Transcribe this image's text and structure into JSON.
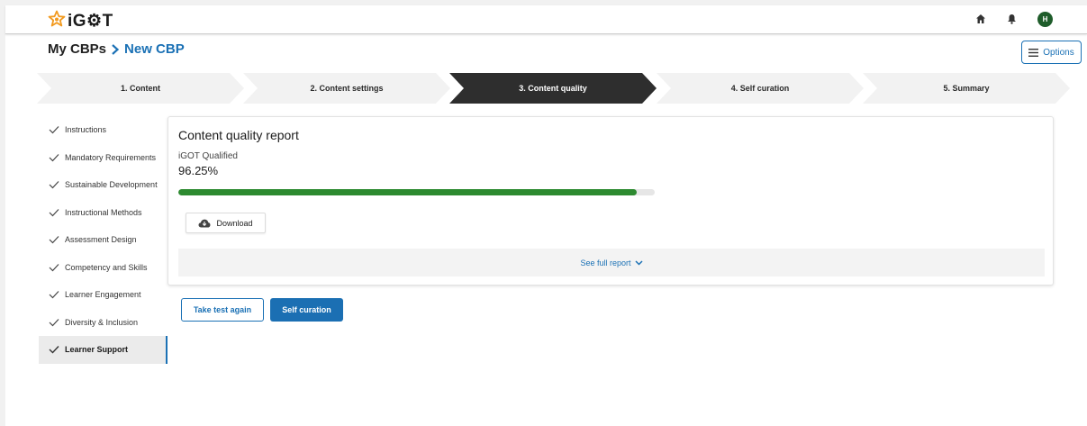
{
  "app": {
    "logo_text": "iG⚙T",
    "brand_color": "#1b71b5"
  },
  "topbar": {
    "avatar_initial": "H"
  },
  "breadcrumb": {
    "root": "My CBPs",
    "current": "New CBP"
  },
  "options_label": "Options",
  "stepper": {
    "steps": [
      {
        "label": "1. Content"
      },
      {
        "label": "2. Content settings"
      },
      {
        "label": "3. Content quality"
      },
      {
        "label": "4. Self curation"
      },
      {
        "label": "5. Summary"
      }
    ],
    "active_index": 2
  },
  "sidebar": {
    "items": [
      {
        "label": "Instructions"
      },
      {
        "label": "Mandatory Requirements"
      },
      {
        "label": "Sustainable Development"
      },
      {
        "label": "Instructional Methods"
      },
      {
        "label": "Assessment Design"
      },
      {
        "label": "Competency and Skills"
      },
      {
        "label": "Learner Engagement"
      },
      {
        "label": "Diversity & Inclusion"
      },
      {
        "label": "Learner Support"
      }
    ],
    "selected_index": 8
  },
  "report": {
    "title": "Content quality report",
    "status": "iGOT Qualified",
    "score": "96.25%",
    "progress_fraction": 0.9625,
    "progress_color": "#2d8a30",
    "download_label": "Download",
    "full_report_label": "See full report"
  },
  "actions": {
    "retake_label": "Take test again",
    "self_curation_label": "Self curation"
  }
}
